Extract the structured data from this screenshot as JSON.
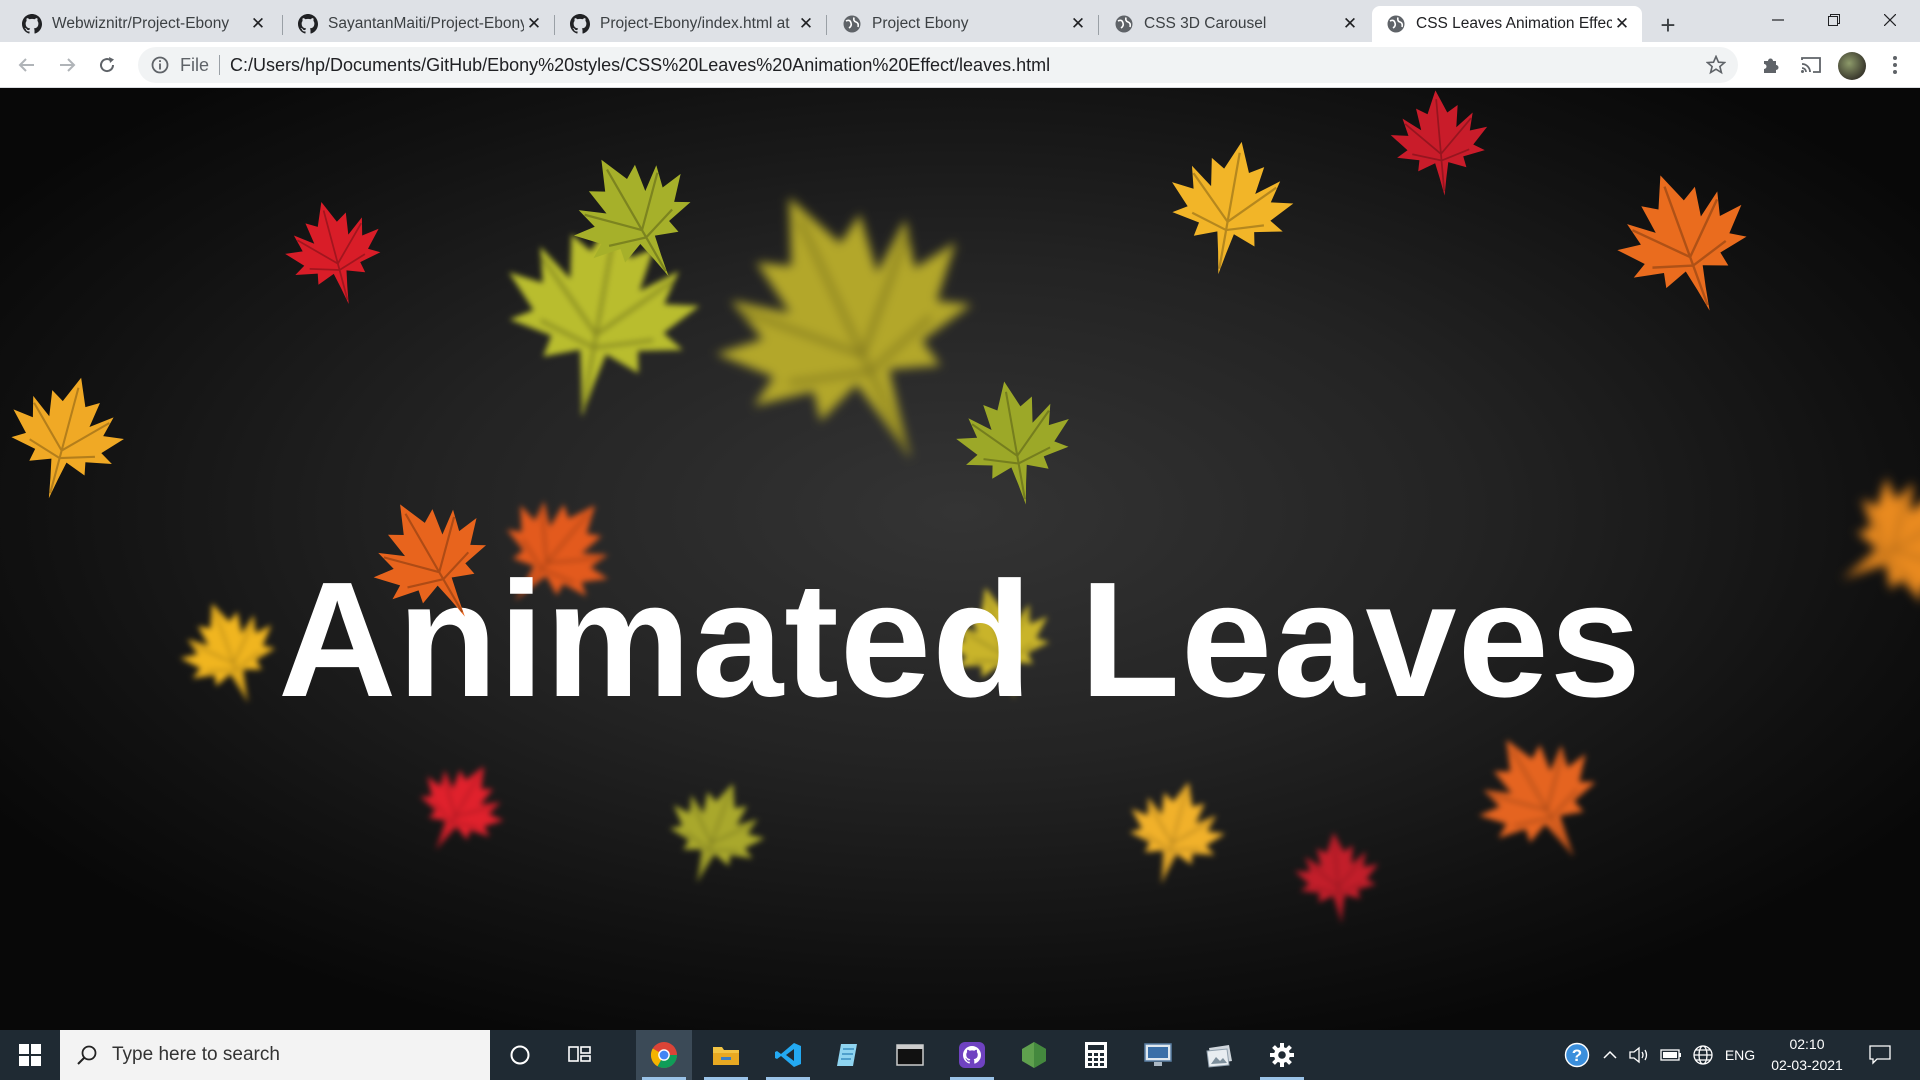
{
  "browser": {
    "tabs": [
      {
        "title": "Webwiznitr/Project-Ebony",
        "icon": "github-icon",
        "active": false
      },
      {
        "title": "SayantanMaiti/Project-Ebony",
        "icon": "github-icon",
        "active": false
      },
      {
        "title": "Project-Ebony/index.html at",
        "icon": "github-icon",
        "active": false
      },
      {
        "title": "Project Ebony",
        "icon": "globe-icon",
        "active": false
      },
      {
        "title": "CSS 3D Carousel",
        "icon": "globe-icon",
        "active": false
      },
      {
        "title": "CSS Leaves Animation Effect",
        "icon": "globe-icon",
        "active": true
      }
    ],
    "address": {
      "scheme_label": "File",
      "url": "C:/Users/hp/Documents/GitHub/Ebony%20styles/CSS%20Leaves%20Animation%20Effect/leaves.html"
    }
  },
  "page": {
    "headline": "Animated Leaves"
  },
  "taskbar": {
    "search_placeholder": "Type here to search",
    "pinned": [
      "chrome-icon",
      "file-explorer-icon",
      "vscode-icon",
      "notepad-icon",
      "terminal-icon",
      "github-desktop-icon",
      "nodejs-icon",
      "calculator-icon",
      "remote-desktop-icon",
      "photos-icon",
      "settings-icon"
    ],
    "tray": {
      "language": "ENG",
      "time": "02:10",
      "date": "02-03-2021"
    }
  },
  "colors": {
    "tabstrip": "#dee1e6",
    "taskbar": "#1f2a33",
    "leaf_red": "#d71f2a",
    "leaf_orange": "#e8651c",
    "leaf_yellow": "#f2b321",
    "leaf_green": "#9aa824"
  }
}
